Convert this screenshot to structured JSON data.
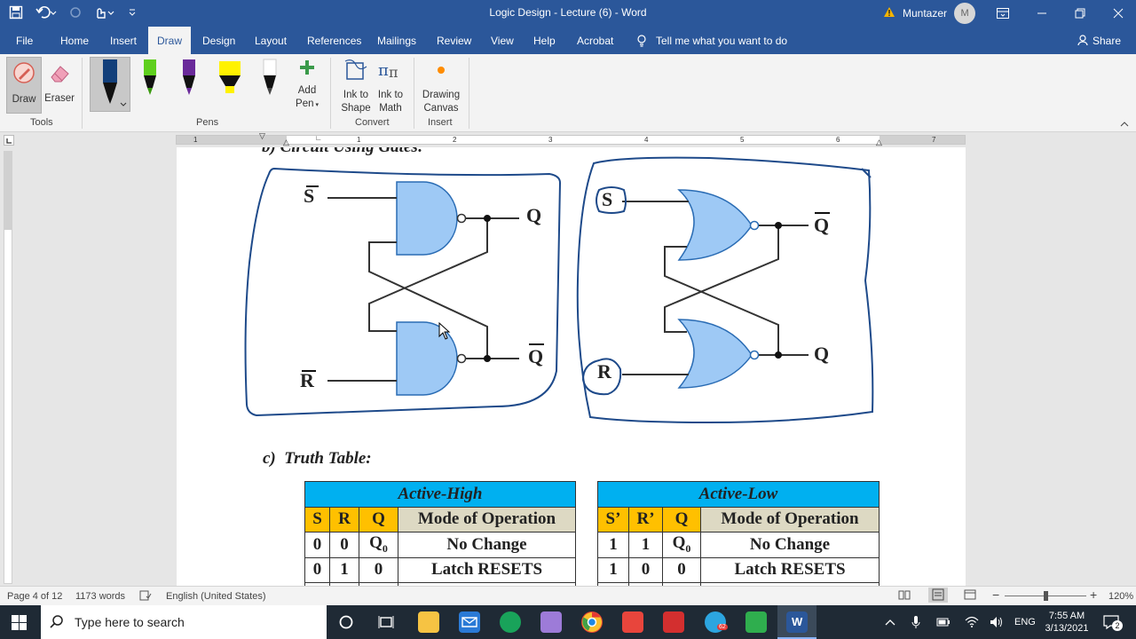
{
  "window": {
    "title": "Logic Design - Lecture (6) - Word",
    "user_name": "Muntazer",
    "avatar_initial": "M"
  },
  "tabs": [
    "File",
    "Home",
    "Insert",
    "Draw",
    "Design",
    "Layout",
    "References",
    "Mailings",
    "Review",
    "View",
    "Help",
    "Acrobat"
  ],
  "tell_me": "Tell me what you want to do",
  "share": "Share",
  "ribbon": {
    "tools": {
      "draw": "Draw",
      "eraser": "Eraser",
      "label": "Tools"
    },
    "pens": {
      "add_pen_1": "Add",
      "add_pen_2": "Pen",
      "label": "Pens"
    },
    "convert": {
      "ink_shape_1": "Ink to",
      "ink_shape_2": "Shape",
      "ink_math_1": "Ink to",
      "ink_math_2": "Math",
      "label": "Convert"
    },
    "insert": {
      "canvas_1": "Drawing",
      "canvas_2": "Canvas",
      "label": "Insert"
    }
  },
  "ruler_numbers": [
    "1",
    "1",
    "2",
    "3",
    "4",
    "5",
    "6",
    "7"
  ],
  "document": {
    "heading_b": "b) Circuit Using Gates:",
    "heading_c_letter": "c)",
    "heading_c": "Truth Table:",
    "circuit_left": {
      "s_label": "S",
      "r_label": "R",
      "q_label": "Q",
      "qbar_label": "Q"
    },
    "circuit_right": {
      "s_label": "S",
      "r_label": "R",
      "qbar_label": "Q",
      "q_label": "Q"
    },
    "table_high": {
      "title": "Active-High",
      "headers": [
        "S",
        "R",
        "Q",
        "Mode of Operation"
      ],
      "rows": [
        {
          "a": "0",
          "b": "0",
          "q": "Q",
          "q_sub": "0",
          "mode": "No Change"
        },
        {
          "a": "0",
          "b": "1",
          "q": "0",
          "q_sub": "",
          "mode": "Latch RESETS"
        }
      ]
    },
    "table_low": {
      "title": "Active-Low",
      "headers": [
        "S’",
        "R’",
        "Q",
        "Mode of Operation"
      ],
      "rows": [
        {
          "a": "1",
          "b": "1",
          "q": "Q",
          "q_sub": "0",
          "mode": "No Change"
        },
        {
          "a": "1",
          "b": "0",
          "q": "0",
          "q_sub": "",
          "mode": "Latch RESETS"
        }
      ]
    }
  },
  "status": {
    "page": "Page 4 of 12",
    "words": "1173 words",
    "language": "English (United States)",
    "zoom": "120%",
    "zoom_value": 120
  },
  "taskbar": {
    "search_placeholder": "Type here to search",
    "language": "ENG",
    "time": "7:55 AM",
    "date": "3/13/2021",
    "telegram_badge": "62",
    "notification_count": "2"
  },
  "colors": {
    "word_blue": "#2b579a",
    "gate_fill": "#9ec9f5",
    "ink_blue": "#1e4a8a",
    "table_header": "#00b0f0",
    "table_subheader": "#ffc000"
  }
}
